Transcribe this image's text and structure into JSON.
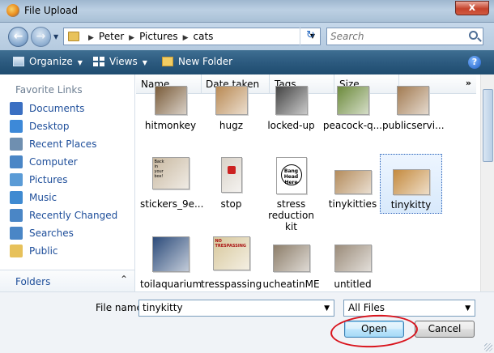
{
  "window": {
    "title": "File Upload",
    "close_label": "x"
  },
  "address": {
    "crumbs": [
      "Peter",
      "Pictures",
      "cats"
    ],
    "search_placeholder": "Search"
  },
  "toolbar": {
    "organize_label": "Organize",
    "views_label": "Views",
    "new_folder_label": "New Folder",
    "help_label": "?"
  },
  "sidebar": {
    "title": "Favorite Links",
    "items": [
      {
        "label": "Documents",
        "icon": "documents-icon",
        "color": "#3a6fc2"
      },
      {
        "label": "Desktop",
        "icon": "desktop-icon",
        "color": "#3d89d8"
      },
      {
        "label": "Recent Places",
        "icon": "recent-places-icon",
        "color": "#6f8fb0"
      },
      {
        "label": "Computer",
        "icon": "computer-icon",
        "color": "#4a86c6"
      },
      {
        "label": "Pictures",
        "icon": "pictures-icon",
        "color": "#5a9bd6"
      },
      {
        "label": "Music",
        "icon": "music-icon",
        "color": "#3f8ad1"
      },
      {
        "label": "Recently Changed",
        "icon": "recently-changed-icon",
        "color": "#4a86c6"
      },
      {
        "label": "Searches",
        "icon": "searches-icon",
        "color": "#4a86c6"
      },
      {
        "label": "Public",
        "icon": "public-folder-icon",
        "color": "#e7c15a"
      }
    ],
    "folders_label": "Folders"
  },
  "columns": {
    "name": "Name",
    "date_taken": "Date taken",
    "tags": "Tags",
    "size": "Size",
    "more": "»"
  },
  "files": [
    {
      "name": "hitmonkey",
      "tone": "#7a5c3a"
    },
    {
      "name": "hugz",
      "tone": "#b98a54"
    },
    {
      "name": "locked-up",
      "tone": "#444444"
    },
    {
      "name": "peacock-q...",
      "tone": "#6c8a3c"
    },
    {
      "name": "publicservi...",
      "tone": "#a27b52"
    },
    {
      "name": "stickers_9e...",
      "tone": "#c9b9a1"
    },
    {
      "name": "stop",
      "tone": "#d9d2c8"
    },
    {
      "name": "stress reduction kit",
      "tone": "#f2f2f2"
    },
    {
      "name": "tinykitties",
      "tone": "#b48c5c"
    },
    {
      "name": "tinykitty",
      "tone": "#c48a3e",
      "selected": true
    },
    {
      "name": "toilaquarium",
      "tone": "#2c4b7a"
    },
    {
      "name": "tresspassing",
      "tone": "#d7c79b"
    },
    {
      "name": "ucheatinME",
      "tone": "#8d7e6a"
    },
    {
      "name": "untitled",
      "tone": "#9b8c7a"
    }
  ],
  "thumb_text": {
    "stress": "Bang\nHead\nHere",
    "sticker": "Back\nin\nyour\nbox!",
    "tress": "NO\nTRESPASSING"
  },
  "bottom": {
    "file_name_label": "File name:",
    "file_name_value": "tinykitty",
    "filter_value": "All Files",
    "open_label": "Open",
    "cancel_label": "Cancel"
  },
  "colors": {
    "toolbar": "#2c5a7f",
    "link": "#1e4e9a",
    "annotation": "#d9141d"
  }
}
